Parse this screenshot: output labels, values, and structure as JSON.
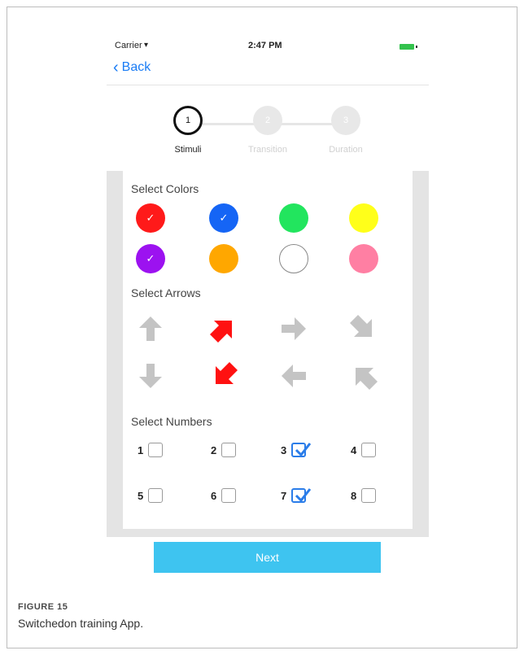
{
  "status_bar": {
    "carrier": "Carrier",
    "time": "2:47 PM"
  },
  "nav": {
    "back_label": "Back"
  },
  "stepper": {
    "steps": [
      {
        "number": "1",
        "label": "Stimuli",
        "state": "active"
      },
      {
        "number": "2",
        "label": "Transition",
        "state": "inactive"
      },
      {
        "number": "3",
        "label": "Duration",
        "state": "inactive"
      }
    ]
  },
  "colors": {
    "title": "Select Colors",
    "items": [
      {
        "color": "#ff1a1a",
        "checked": true
      },
      {
        "color": "#1565f5",
        "checked": true
      },
      {
        "color": "#22e55e",
        "checked": false
      },
      {
        "color": "#ffff1a",
        "checked": false
      },
      {
        "color": "#9c12f0",
        "checked": true
      },
      {
        "color": "#ffa700",
        "checked": false
      },
      {
        "color": "#ffffff",
        "checked": false
      },
      {
        "color": "#ff7fa3",
        "checked": false
      }
    ]
  },
  "arrows": {
    "title": "Select Arrows",
    "items": [
      {
        "icon": "arrow-up-icon",
        "direction": "up",
        "selected": false
      },
      {
        "icon": "arrow-up-right-icon",
        "direction": "up-right",
        "selected": true
      },
      {
        "icon": "arrow-right-icon",
        "direction": "right",
        "selected": false
      },
      {
        "icon": "arrow-down-right-icon",
        "direction": "down-right",
        "selected": false
      },
      {
        "icon": "arrow-down-icon",
        "direction": "down",
        "selected": false
      },
      {
        "icon": "arrow-down-left-icon",
        "direction": "down-left",
        "selected": true
      },
      {
        "icon": "arrow-left-icon",
        "direction": "left",
        "selected": false
      },
      {
        "icon": "arrow-up-left-icon",
        "direction": "up-left",
        "selected": false
      }
    ],
    "selected_color": "#ff1111",
    "unselected_color": "#c4c4c4"
  },
  "numbers": {
    "title": "Select Numbers",
    "items": [
      {
        "label": "1",
        "checked": false
      },
      {
        "label": "2",
        "checked": false
      },
      {
        "label": "3",
        "checked": true
      },
      {
        "label": "4",
        "checked": false
      },
      {
        "label": "5",
        "checked": false
      },
      {
        "label": "6",
        "checked": false
      },
      {
        "label": "7",
        "checked": true
      },
      {
        "label": "8",
        "checked": false
      }
    ]
  },
  "next_button": {
    "label": "Next"
  },
  "caption": {
    "label": "FIGURE 15",
    "text": "Switchedon training App."
  }
}
